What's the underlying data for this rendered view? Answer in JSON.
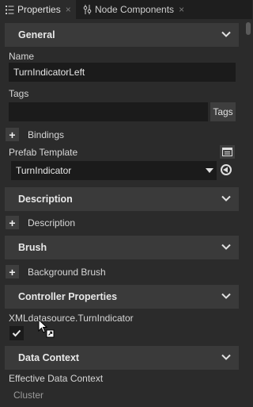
{
  "tabs": {
    "properties_label": "Properties",
    "node_components_label": "Node Components",
    "close_glyph": "×"
  },
  "general": {
    "header": "General",
    "name_label": "Name",
    "name_value": "TurnIndicatorLeft",
    "tags_label": "Tags",
    "tags_value": "",
    "tags_button": "Tags",
    "bindings_label": "Bindings",
    "prefab_label": "Prefab Template",
    "prefab_value": "TurnIndicator"
  },
  "description": {
    "header": "Description",
    "row_label": "Description"
  },
  "brush": {
    "header": "Brush",
    "row_label": "Background Brush"
  },
  "controller": {
    "header": "Controller Properties",
    "property_label": "XMLdatasource.TurnIndicator",
    "checked": true
  },
  "data_context": {
    "header": "Data Context",
    "effective_label": "Effective Data Context",
    "effective_value": "Cluster"
  },
  "colors": {
    "background": "#2b2b2b",
    "section_header": "#3a3a3a",
    "field": "#1b1b1b"
  },
  "icons": [
    "properties-icon",
    "node-components-icon",
    "close-icon",
    "chevron-down-icon",
    "plus-icon",
    "edit-template-icon",
    "revert-icon",
    "checkmark-icon",
    "cursor-icon"
  ]
}
